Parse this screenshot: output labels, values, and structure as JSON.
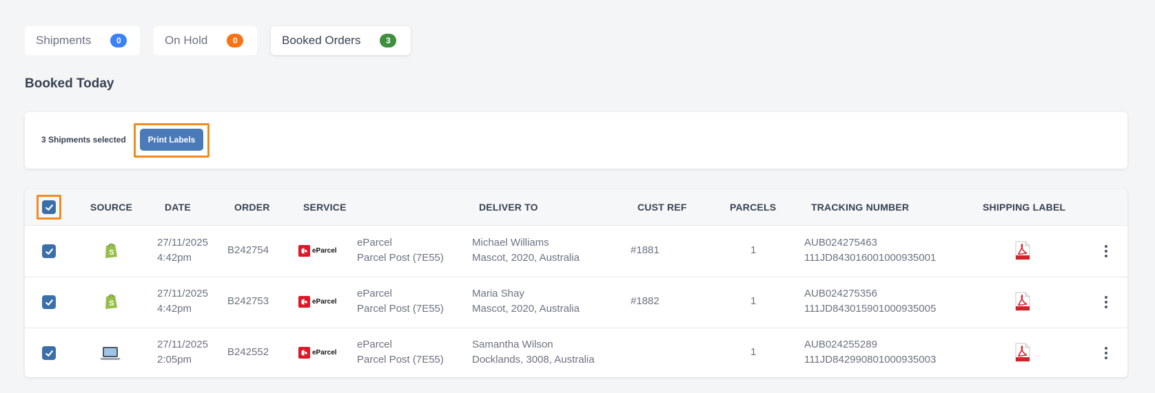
{
  "tabs": [
    {
      "label": "Shipments",
      "count": "0",
      "color": "#3b82f6"
    },
    {
      "label": "On Hold",
      "count": "0",
      "color": "#f97316"
    },
    {
      "label": "Booked Orders",
      "count": "3",
      "color": "#3f8f3f"
    }
  ],
  "active_tab": "Booked Orders",
  "section_title": "Booked Today",
  "selection": {
    "text": "3 Shipments selected",
    "print_button": "Print Labels"
  },
  "table": {
    "headers": {
      "source": "SOURCE",
      "date": "DATE",
      "order": "ORDER",
      "service": "SERVICE",
      "deliver_to": "DELIVER TO",
      "cust_ref": "CUST REF",
      "parcels": "PARCELS",
      "tracking": "TRACKING NUMBER",
      "label": "SHIPPING LABEL"
    },
    "rows": [
      {
        "checked": true,
        "source_icon": "shopify-icon",
        "date": "27/11/2025",
        "time": "4:42pm",
        "order": "B242754",
        "carrier_logo": "eParcel",
        "service_name": "eParcel",
        "service_type": "Parcel Post (7E55)",
        "recipient": "Michael Williams",
        "address": "Mascot, 2020, Australia",
        "cust_ref": "#1881",
        "parcels": "1",
        "tracking_1": "AUB024275463",
        "tracking_2": "111JD843016001000935001",
        "label_icon": "pdf-icon"
      },
      {
        "checked": true,
        "source_icon": "shopify-icon",
        "date": "27/11/2025",
        "time": "4:42pm",
        "order": "B242753",
        "carrier_logo": "eParcel",
        "service_name": "eParcel",
        "service_type": "Parcel Post (7E55)",
        "recipient": "Maria Shay",
        "address": "Mascot, 2020, Australia",
        "cust_ref": "#1882",
        "parcels": "1",
        "tracking_1": "AUB024275356",
        "tracking_2": "111JD843015901000935005",
        "label_icon": "pdf-icon"
      },
      {
        "checked": true,
        "source_icon": "laptop-icon",
        "date": "27/11/2025",
        "time": "2:05pm",
        "order": "B242552",
        "carrier_logo": "eParcel",
        "service_name": "eParcel",
        "service_type": "Parcel Post (7E55)",
        "recipient": "Samantha Wilson",
        "address": "Docklands, 3008, Australia",
        "cust_ref": "",
        "parcels": "1",
        "tracking_1": "AUB024255289",
        "tracking_2": "111JD842990801000935003",
        "label_icon": "pdf-icon"
      }
    ]
  },
  "colors": {
    "accent": "#3b6fa8",
    "highlight": "#f28a1e",
    "background": "#f4f5f7"
  }
}
